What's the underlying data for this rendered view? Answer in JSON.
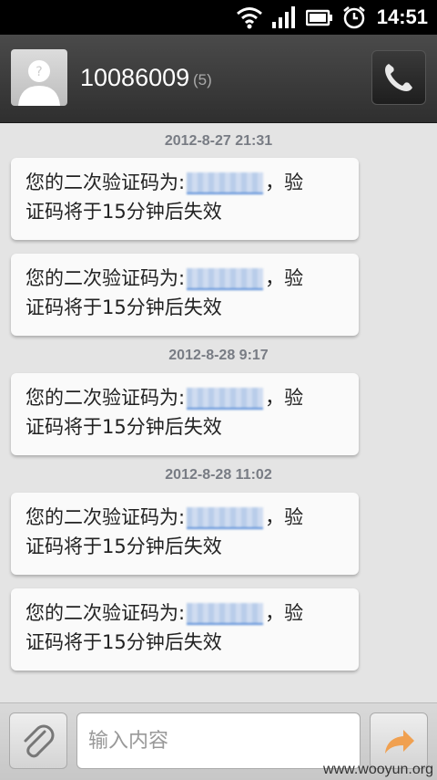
{
  "status_bar": {
    "time": "14:51",
    "icons": [
      "wifi-icon",
      "signal-icon",
      "battery-icon",
      "alarm-icon"
    ]
  },
  "header": {
    "contact": "10086009",
    "count": "(5)",
    "avatar_icon": "avatar-placeholder-icon",
    "call_icon": "phone-icon"
  },
  "messages": [
    {
      "timestamp": "2012-8-27 21:31",
      "line1_prefix": "您的二次验证码为:",
      "code": "",
      "line1_suffix": "，验",
      "line2": "证码将于15分钟后失效"
    },
    {
      "timestamp": "",
      "line1_prefix": "您的二次验证码为:",
      "code": "",
      "line1_suffix": "，验",
      "line2": "证码将于15分钟后失效"
    },
    {
      "timestamp": "2012-8-28 9:17",
      "line1_prefix": "您的二次验证码为:",
      "code": "",
      "line1_suffix": "，验",
      "line2": "证码将于15分钟后失效"
    },
    {
      "timestamp": "2012-8-28 11:02",
      "line1_prefix": "您的二次验证码为:",
      "code": "",
      "line1_suffix": "，验",
      "line2": "证码将于15分钟后失效"
    },
    {
      "timestamp": "",
      "line1_prefix": "您的二次验证码为:",
      "code": "",
      "line1_suffix": "，验",
      "line2": "证码将于15分钟后失效"
    }
  ],
  "composer": {
    "placeholder": "输入内容",
    "attach_icon": "paperclip-icon",
    "send_icon": "send-arrow-icon"
  },
  "watermark": "www.wooyun.org",
  "colors": {
    "header_bg": "#3a3a3a",
    "link_blue": "#5a8ed8",
    "timestamp_text": "#787c84",
    "send_arrow": "#f0a050"
  }
}
